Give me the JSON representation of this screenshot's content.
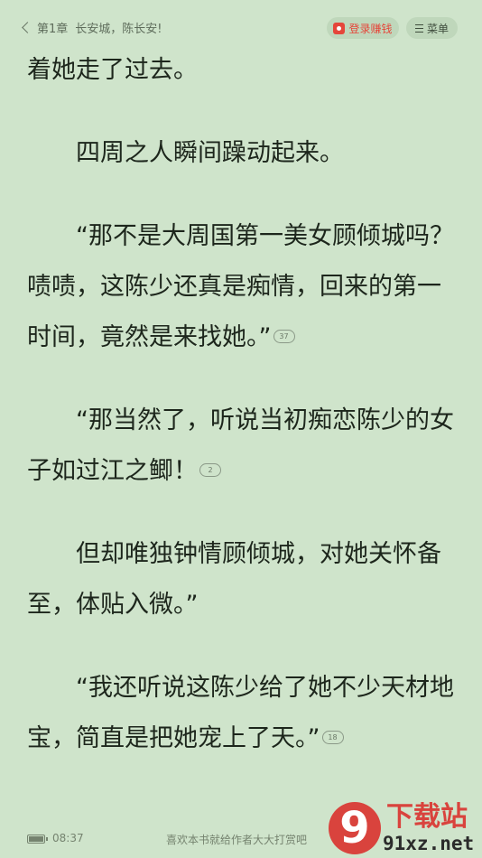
{
  "header": {
    "chapter": "第1章",
    "chapter_title": "长安城，陈长安!",
    "login_label": "登录赚钱",
    "menu_label": "菜单"
  },
  "paragraphs": [
    {
      "text": "着她走了过去。",
      "comment_count": null
    },
    {
      "text": "四周之人瞬间躁动起来。",
      "comment_count": null
    },
    {
      "text": "“那不是大周国第一美女顾倾城吗？啧啧，这陈少还真是痴情，回来的第一时间，竟然是来找她。”",
      "comment_count": "37"
    },
    {
      "text": "“那当然了，听说当初痴恋陈少的女子如过江之鲫！",
      "comment_count": "2"
    },
    {
      "text": "但却唯独钟情顾倾城，对她关怀备至，体贴入微。”",
      "comment_count": null
    },
    {
      "text": "“我还听说这陈少给了她不少天材地宝，简直是把她宠上了天。”",
      "comment_count": "18"
    }
  ],
  "footer": {
    "time": "08:37",
    "tip": "喜欢本书就给作者大大打赏吧"
  },
  "watermark": {
    "logo_digit": "9",
    "site_name": "下载站",
    "site_url": "91xz.net"
  },
  "icons": {
    "back": "chevron-left-icon",
    "login": "red-envelope-icon",
    "menu": "menu-lines-icon",
    "comment": "comment-bubble-icon",
    "battery": "battery-icon"
  },
  "colors": {
    "background": "#cfe4cb",
    "text": "#1d261c",
    "accent": "#e5463a",
    "watermark_red": "#d9433d"
  }
}
